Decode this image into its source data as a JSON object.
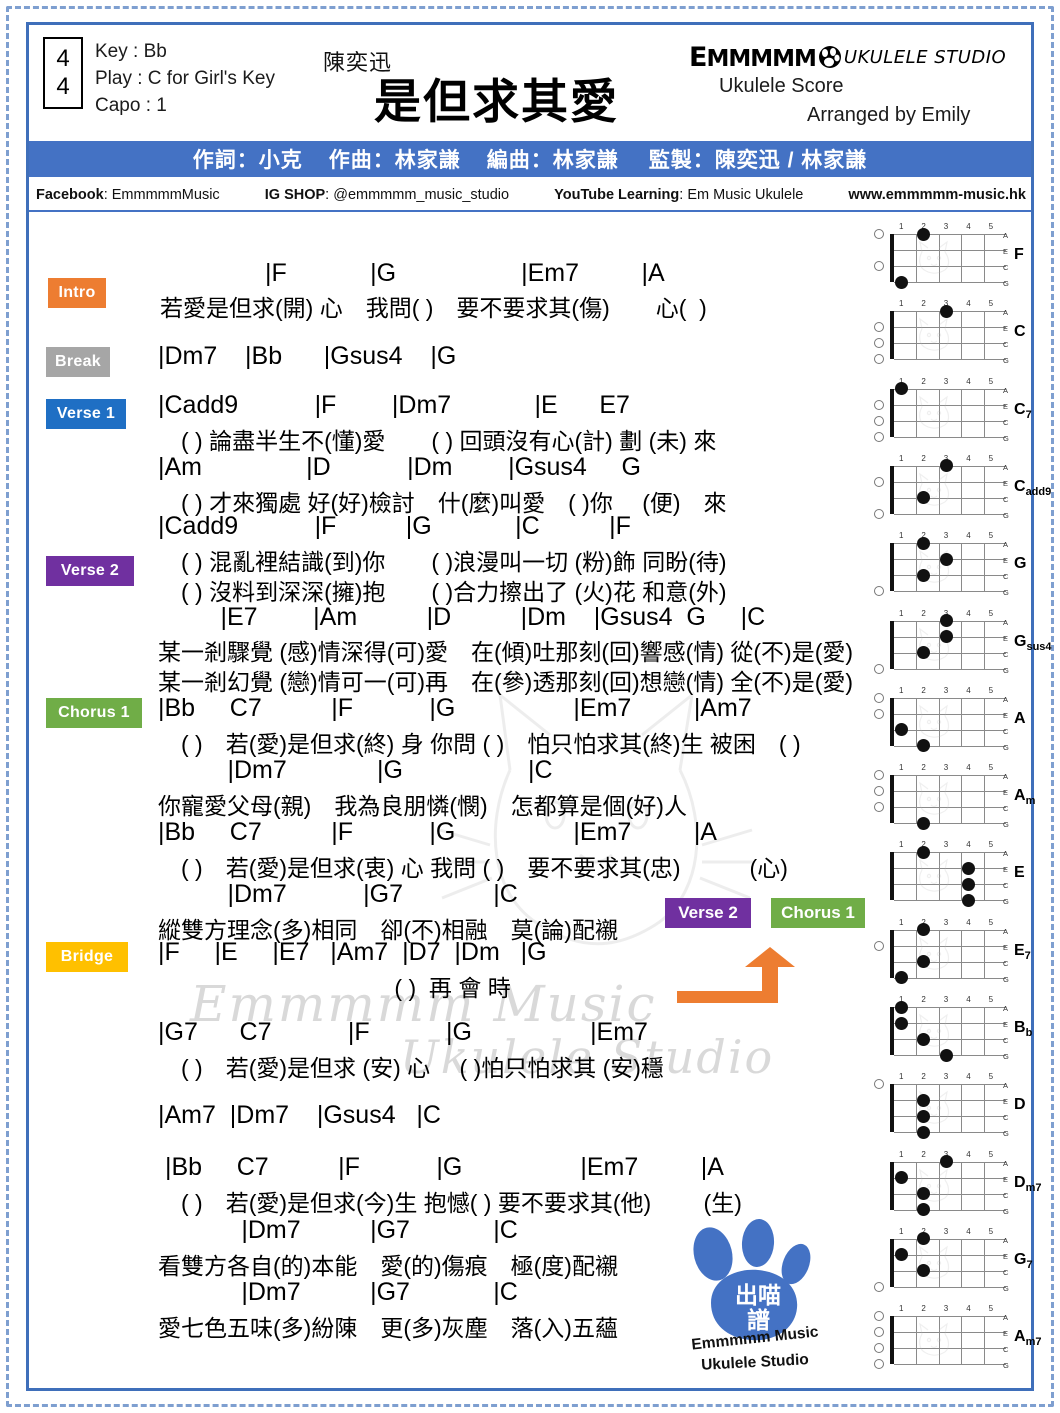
{
  "header": {
    "time_signature_top": "4",
    "time_signature_bottom": "4",
    "key_line": "Key : Bb",
    "play_line": "Play : C for Girl's Key",
    "capo_line": "Capo : 1",
    "artist": "陳奕迅",
    "title": "是但求其愛",
    "brand_em": "MMMMM",
    "brand_em_cap": "E",
    "brand_studio": "UKULELE STUDIO",
    "score_label": "Ukulele Score",
    "arranged_by": "Arranged by Emily"
  },
  "credits": {
    "lyricist": "作詞：小克",
    "composer": "作曲：林家謙",
    "arranger": "編曲：林家謙",
    "producer": "監製：陳奕迅 / 林家謙"
  },
  "social": {
    "facebook_label": "Facebook",
    "facebook_value": ": EmmmmmMusic",
    "ig_label": "IG SHOP",
    "ig_value": ": @emmmmm_music_studio",
    "youtube_label": "YouTube Learning",
    "youtube_value": ": Em Music Ukulele",
    "website": "www.emmmmm-music.hk"
  },
  "watermark": {
    "line1": "Emmmmm Music",
    "line2": "Ukulele Studio"
  },
  "tags": {
    "intro": "Intro",
    "break": "Break",
    "verse1": "Verse 1",
    "verse2": "Verse 2",
    "chorus1": "Chorus 1",
    "bridge": "Bridge"
  },
  "nav": {
    "verse2": "Verse 2",
    "chorus1": "Chorus 1"
  },
  "score_lines": {
    "intro_chords": "|F            |G                  |Em7         |A",
    "intro_lyrics": "若愛是但求(開) 心　我問( )　要不要求其(傷)　　心(  )",
    "break_chords": "|Dm7    |Bb      |Gsus4    |G",
    "v1_l1_chords": "|Cadd9           |F        |Dm7            |E      E7",
    "v1_l1_lyrics": "　( ) 論盡半生不(懂)愛　　( ) 回頭沒有心(計) 劃 (未) 來",
    "v1_l2_chords": "|Am               |D           |Dm        |Gsus4     G",
    "v1_l2_lyrics": "　( ) 才來獨處 好(好)檢討　什(麼)叫愛　( )你　 (便)　來",
    "v2_l1_chords": "|Cadd9           |F          |G            |C          |F",
    "v2_l1_lyrics": "　( ) 混亂裡結識(到)你　　( )浪漫叫一切 (粉)飾 同盼(待)",
    "v2_l2_lyrics": "　( ) 沒料到深深(擁)抱　　( )合力擦出了 (火)花 和意(外)",
    "v2_l3_chords": "         |E7        |Am          |D          |Dm    |Gsus4  G     |C",
    "v2_l3_lyrics": "某一剎驟覺 (感)情深得(可)愛　在(傾)吐那刻(回)響感(情) 從(不)是(愛)",
    "v2_l4_lyrics": "某一剎幻覺 (戀)情可一(可)再　在(參)透那刻(回)想戀(情) 全(不)是(愛)",
    "c1_l1_chords": "|Bb     C7          |F           |G                 |Em7         |Am7",
    "c1_l1_lyrics": "　( )　若(愛)是但求(終) 身 你問 ( )　怕只怕求其(終)生 被困　( )",
    "c1_l2_chords": "          |Dm7             |G                  |C",
    "c1_l2_lyrics": "你寵愛父母(親)　我為良朋憐(憫)　怎都算是個(好)人",
    "c1_l3_chords": "|Bb     C7          |F           |G                 |Em7         |A",
    "c1_l3_lyrics": "　( )　若(愛)是但求(衷) 心 我問 ( )　要不要求其(忠)　　　(心)",
    "c1_l4_chords": "          |Dm7           |G7             |C",
    "c1_l4_lyrics": "縱雙方理念(多)相同　卻(不)相融　莫(論)配襯",
    "bridge_chords": "|F     |E     |E7   |Am7  |D7  |Dm   |G",
    "bridge_lyrics": "                                     ( )  再 會 時",
    "b2_chords": "|G7      C7           |F           |G                 |Em7",
    "b2_lyrics": "　( )　若(愛)是但求 (安) 心 　( )怕只怕求其 (安)穩",
    "b3_chords": "|Am7  |Dm7    |Gsus4   |C",
    "out_l1_chords": " |Bb     C7          |F           |G                 |Em7         |A",
    "out_l1_lyrics": "　( )　若(愛)是但求(今)生 抱憾( ) 要不要求其(他)　　 (生)",
    "out_l2_chords": "            |Dm7          |G7            |C",
    "out_l2_lyrics": "看雙方各自(的)本能　愛(的)傷痕　極(度)配襯",
    "out_l3_chords": "            |Dm7          |G7            |C",
    "out_l3_lyrics": "愛七色五味(多)紛陳　更(多)灰塵　落(入)五蘊"
  },
  "chord_diagrams": [
    {
      "name": "F",
      "sub": "",
      "open": [
        0,
        2
      ],
      "dots": [
        [
          1,
          3
        ],
        [
          2,
          0
        ]
      ]
    },
    {
      "name": "C",
      "sub": "",
      "open": [
        1,
        2,
        3
      ],
      "dots": [
        [
          3,
          0
        ]
      ]
    },
    {
      "name": "C",
      "sub": "7",
      "open": [
        1,
        2,
        3
      ],
      "dots": [
        [
          1,
          0
        ]
      ]
    },
    {
      "name": "C",
      "sub": "add9",
      "open": [
        1,
        3
      ],
      "dots": [
        [
          3,
          0
        ],
        [
          2,
          2
        ]
      ]
    },
    {
      "name": "G",
      "sub": "",
      "open": [
        3
      ],
      "dots": [
        [
          2,
          0
        ],
        [
          3,
          1
        ],
        [
          2,
          2
        ]
      ]
    },
    {
      "name": "G",
      "sub": "sus4",
      "open": [
        3
      ],
      "dots": [
        [
          3,
          0
        ],
        [
          3,
          1
        ],
        [
          2,
          2
        ]
      ]
    },
    {
      "name": "A",
      "sub": "",
      "open": [
        0,
        1
      ],
      "dots": [
        [
          1,
          2
        ],
        [
          2,
          3
        ]
      ]
    },
    {
      "name": "A",
      "sub": "m",
      "open": [
        0,
        1,
        2
      ],
      "dots": [
        [
          2,
          3
        ]
      ]
    },
    {
      "name": "E",
      "sub": "",
      "open": [],
      "dots": [
        [
          2,
          0
        ],
        [
          4,
          1
        ],
        [
          4,
          2
        ],
        [
          4,
          3
        ]
      ]
    },
    {
      "name": "E",
      "sub": "7",
      "open": [
        1
      ],
      "dots": [
        [
          2,
          0
        ],
        [
          2,
          2
        ],
        [
          1,
          3
        ]
      ]
    },
    {
      "name": "B",
      "sub": "b",
      "open": [],
      "dots": [
        [
          1,
          0
        ],
        [
          1,
          1
        ],
        [
          2,
          2
        ],
        [
          3,
          3
        ]
      ]
    },
    {
      "name": "D",
      "sub": "",
      "open": [
        0
      ],
      "dots": [
        [
          2,
          1
        ],
        [
          2,
          2
        ],
        [
          2,
          3
        ]
      ]
    },
    {
      "name": "D",
      "sub": "m7",
      "open": [],
      "dots": [
        [
          3,
          0
        ],
        [
          1,
          1
        ],
        [
          2,
          2
        ],
        [
          2,
          3
        ]
      ]
    },
    {
      "name": "G",
      "sub": "7",
      "open": [
        3
      ],
      "dots": [
        [
          2,
          0
        ],
        [
          1,
          1
        ],
        [
          2,
          2
        ]
      ]
    },
    {
      "name": "A",
      "sub": "m7",
      "open": [
        0,
        1,
        2,
        3
      ],
      "dots": []
    }
  ],
  "diagram_labels": {
    "frets": [
      "1",
      "2",
      "3",
      "4",
      "5"
    ],
    "strings": [
      "A",
      "E",
      "C",
      "G"
    ]
  },
  "paw_logo": {
    "cn_text_1": "出喵",
    "cn_text_2": "譜",
    "line1": "Emmmmm Music",
    "line2": "Ukulele Studio"
  },
  "colors": {
    "frame": "#3f6fba",
    "credit_bar": "#4472c4",
    "intro": "#ed7d31",
    "break": "#a6a6a6",
    "verse1": "#1f6fc4",
    "verse2": "#7030a0",
    "chorus": "#70ad47",
    "bridge": "#ffc000",
    "arrow": "#ed7d31",
    "paw": "#4472c4"
  }
}
